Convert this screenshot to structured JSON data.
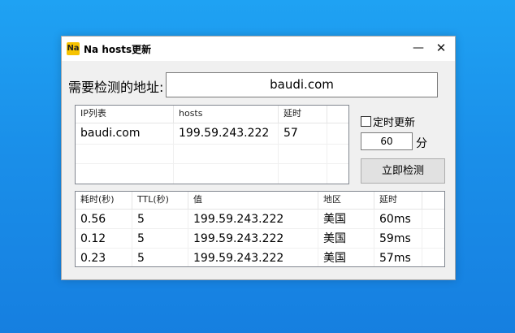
{
  "window": {
    "icon_text": "Na",
    "title": "Na hosts更新",
    "minimize": "—",
    "close": "✕"
  },
  "url": {
    "label": "需要检测的地址:",
    "value": "baudi.com"
  },
  "ip_table": {
    "headers": [
      "IP列表",
      "hosts",
      "延时",
      ""
    ],
    "rows": [
      [
        "baudi.com",
        "199.59.243.222",
        "57",
        ""
      ]
    ]
  },
  "timer": {
    "checkbox_label": "定时更新",
    "checked": false,
    "minutes": "60",
    "unit": "分"
  },
  "detect_button": "立即检测",
  "results_table": {
    "headers": [
      "耗时(秒)",
      "TTL(秒)",
      "值",
      "地区",
      "延时",
      ""
    ],
    "rows": [
      [
        "0.56",
        "5",
        "199.59.243.222",
        "美国",
        "60ms",
        ""
      ],
      [
        "0.12",
        "5",
        "199.59.243.222",
        "美国",
        "59ms",
        ""
      ],
      [
        "0.23",
        "5",
        "199.59.243.222",
        "美国",
        "57ms",
        ""
      ]
    ]
  },
  "colors": {
    "desktop": "#1a8fe9",
    "window_bg": "#f0f0f0",
    "icon_bg": "#f7c300"
  }
}
